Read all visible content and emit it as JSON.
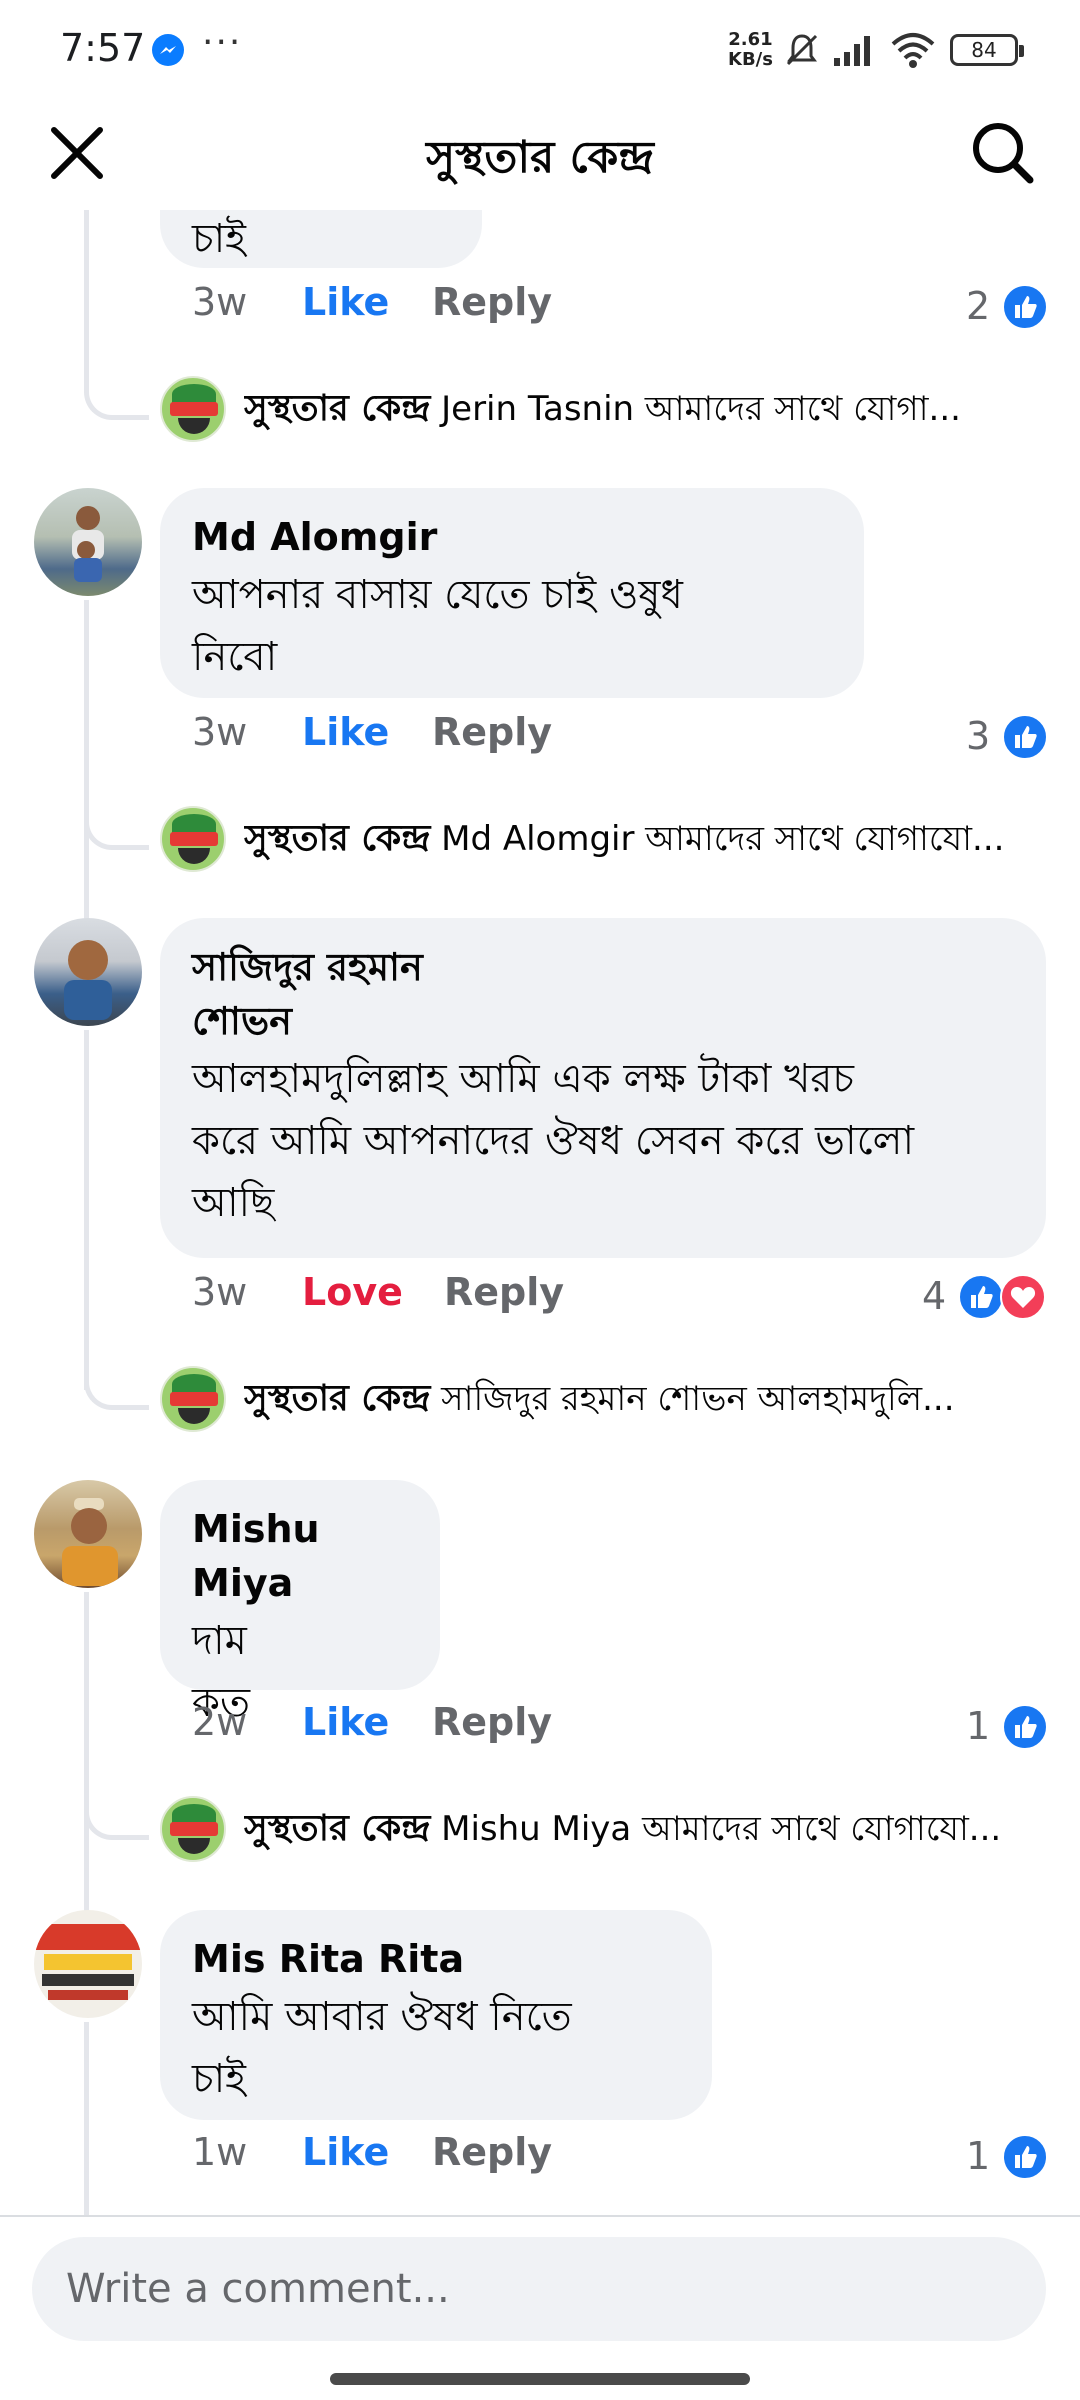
{
  "status_bar": {
    "time": "7:57",
    "dots": "···",
    "speed_value": "2.61",
    "speed_unit": "KB/s",
    "battery": "84"
  },
  "header": {
    "title": "সুস্থতার কেন্দ্র"
  },
  "thread": {
    "partial_comment": {
      "text_fragment": "চাই",
      "time": "3w",
      "action": "Like",
      "reply": "Reply",
      "reaction_count": "2",
      "page_reply": {
        "author": "সুস্থতার কেন্দ্র",
        "text": "Jerin Tasnin আমাদের সাথে যোগা..."
      }
    },
    "comments": [
      {
        "author": "Md Alomgir",
        "lines": [
          "আপনার বাসায় যেতে চাই ওষুধ",
          "নিবো"
        ],
        "time": "3w",
        "action": "Like",
        "reply": "Reply",
        "reaction_count": "3",
        "page_reply": {
          "author": "সুস্থতার কেন্দ্র",
          "text": "Md Alomgir আমাদের সাথে যোগাযো..."
        }
      },
      {
        "author_lines": [
          "সাজিদুর রহমান",
          "শোভন"
        ],
        "lines": [
          "আলহামদুলিল্লাহ আমি এক লক্ষ টাকা খরচ",
          "করে আমি আপনাদের ঔষধ সেবন করে ভালো",
          "আছি"
        ],
        "time": "3w",
        "action": "Love",
        "reply": "Reply",
        "reaction_count": "4",
        "page_reply": {
          "author": "সুস্থতার কেন্দ্র",
          "text": "সাজিদুর রহমান শোভন আলহামদুলি..."
        }
      },
      {
        "author": "Mishu Miya",
        "lines": [
          "দাম",
          "কত"
        ],
        "time": "2w",
        "action": "Like",
        "reply": "Reply",
        "reaction_count": "1",
        "page_reply": {
          "author": "সুস্থতার কেন্দ্র",
          "text": "Mishu Miya আমাদের সাথে যোগাযো..."
        }
      },
      {
        "author": "Mis Rita Rita",
        "lines": [
          "আমি আবার ঔষধ নিতে",
          "চাই"
        ],
        "time": "1w",
        "action": "Like",
        "reply": "Reply",
        "reaction_count": "1"
      }
    ]
  },
  "composer": {
    "placeholder": "Write a comment..."
  },
  "colors": {
    "like_blue": "#1877f2",
    "love_red": "#e41e3f",
    "bubble_gray": "#f0f2f5",
    "meta_gray": "#65676b"
  },
  "icons": {
    "close": "close-icon",
    "search": "search-icon",
    "like_reaction": "thumbs-up-icon",
    "love_reaction": "heart-icon"
  }
}
